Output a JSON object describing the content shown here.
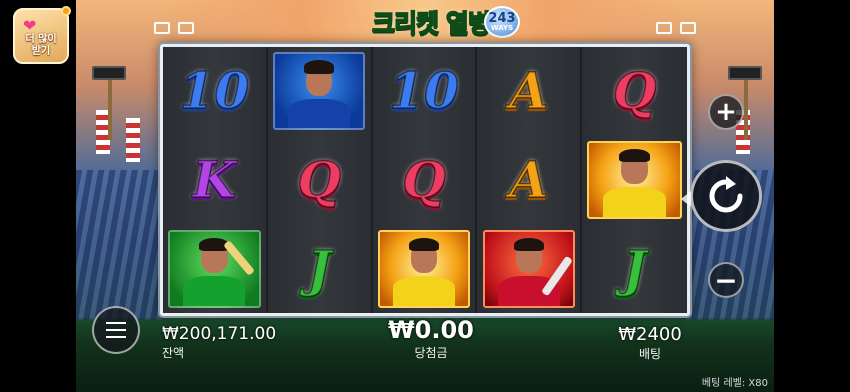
{
  "game": {
    "title": "크리켓 열병",
    "ways_number": "243",
    "ways_label": "WAYS"
  },
  "promo": {
    "line1": "더 많이",
    "line2": "받기"
  },
  "reels": [
    [
      "10",
      "K",
      "cricket-batsman-green"
    ],
    [
      "cricket-player-blue",
      "Q",
      "J"
    ],
    [
      "10",
      "Q",
      "cricket-player-gold"
    ],
    [
      "A",
      "A",
      "cricket-batsman-red"
    ],
    [
      "Q",
      "cricket-player-gold",
      "J"
    ]
  ],
  "balance": {
    "value": "₩200,171.00",
    "label": "잔액"
  },
  "win": {
    "value": "₩0.00",
    "label": "당첨금"
  },
  "bet": {
    "value": "₩2400",
    "label": "배팅"
  },
  "bet_level": {
    "label": "베팅 레벨:",
    "value": "X80"
  },
  "buttons": {
    "plus": "+",
    "minus": "−"
  },
  "icons": {
    "spin": "refresh-icon",
    "menu": "hamburger-menu-icon"
  }
}
